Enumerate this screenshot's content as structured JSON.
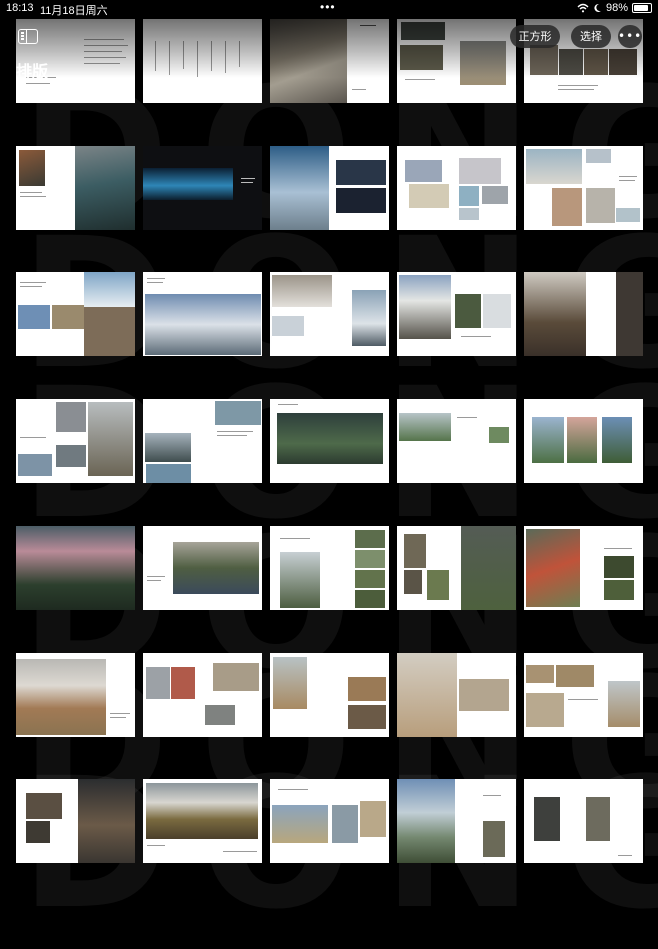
{
  "status_bar": {
    "time": "18:13",
    "date": "11月18日周六",
    "battery": "98%",
    "battery_level": 0.98
  },
  "header": {
    "album_title": "排版",
    "square_button": "正方形",
    "select_button": "选择",
    "more_icon": "ellipsis-icon",
    "sidebar_icon": "sidebar-icon"
  },
  "watermark": [
    "DONG",
    "DONG",
    "DONG",
    "DONG",
    "DONG",
    "DONG"
  ],
  "colors": {
    "background": "#000000",
    "pill_background": "#282828",
    "page": "#ffffff"
  }
}
